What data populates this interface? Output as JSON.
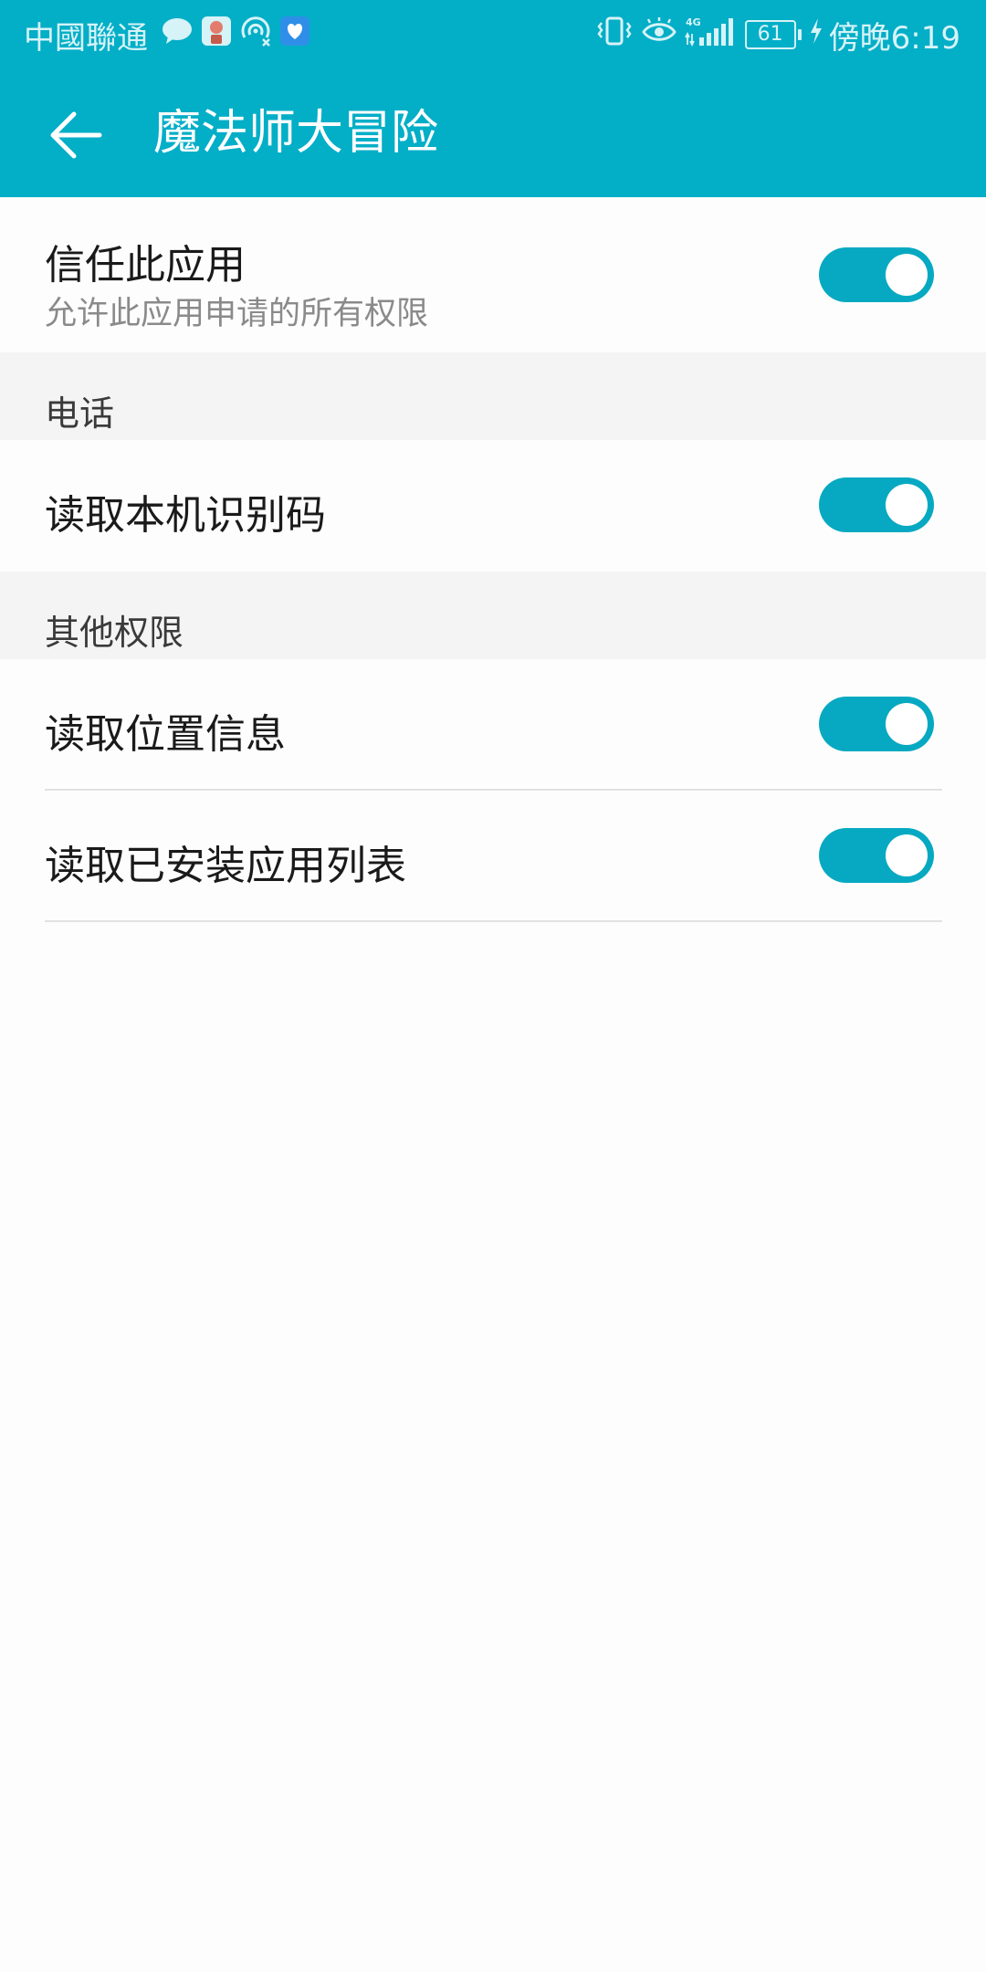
{
  "status_bar": {
    "carrier": "中國聯通",
    "time": "傍晚6:19",
    "battery": "61",
    "network": "4G"
  },
  "app_bar": {
    "title": "魔法师大冒险"
  },
  "trust": {
    "title": "信任此应用",
    "subtitle": "允许此应用申请的所有权限",
    "enabled": true
  },
  "sections": [
    {
      "title": "电话",
      "items": [
        {
          "label": "读取本机识别码",
          "enabled": true
        }
      ]
    },
    {
      "title": "其他权限",
      "items": [
        {
          "label": "读取位置信息",
          "enabled": true
        },
        {
          "label": "读取已安装应用列表",
          "enabled": true
        }
      ]
    }
  ],
  "colors": {
    "accent": "#03aec7",
    "toggle_on": "#06a9c1",
    "section_bg": "#f4f4f4"
  }
}
